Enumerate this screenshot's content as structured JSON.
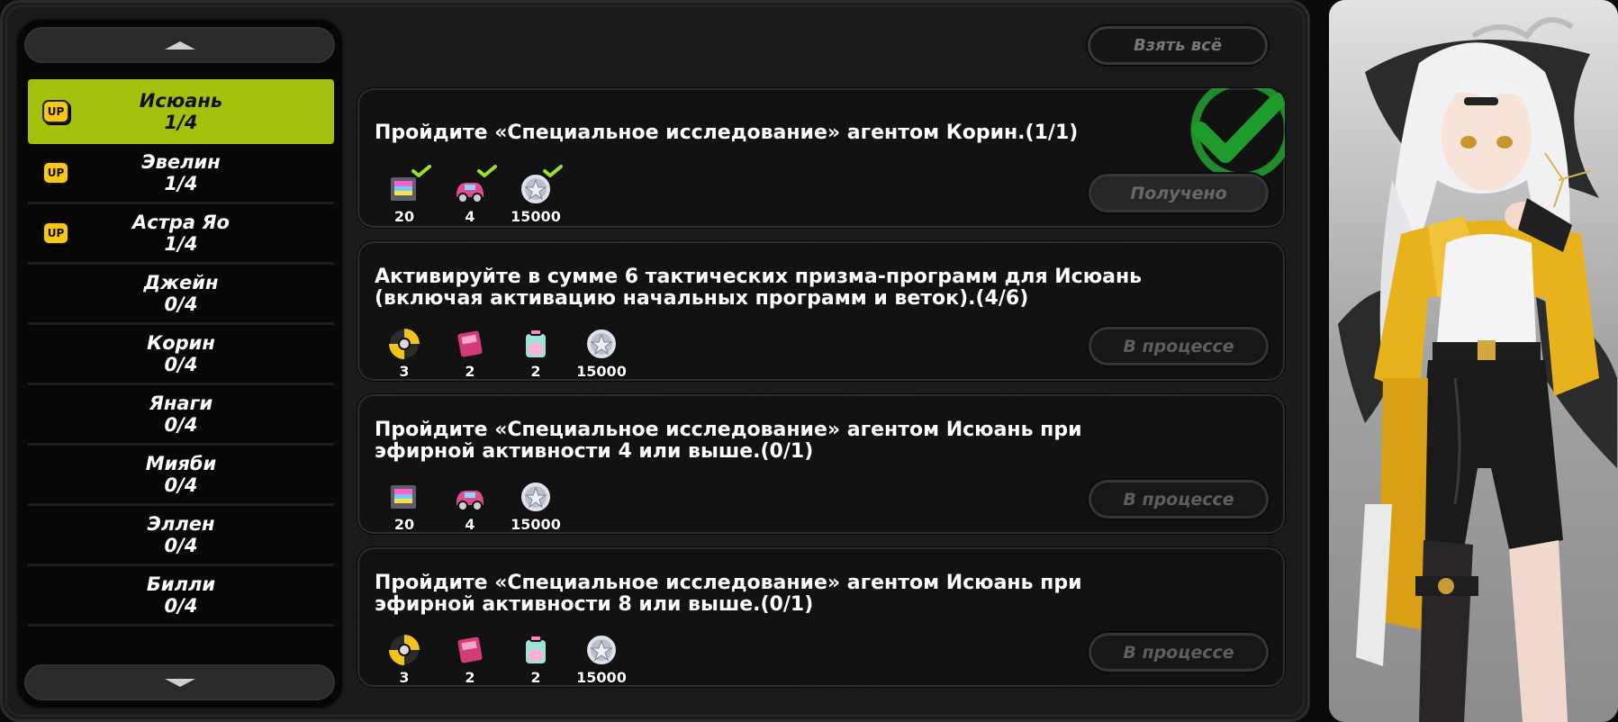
{
  "take_all_label": "Взять всё",
  "sidebar": {
    "agents": [
      {
        "name": "Исюань",
        "progress": "1/4",
        "up": "UP",
        "active": true
      },
      {
        "name": "Эвелин",
        "progress": "1/4",
        "up": "UP"
      },
      {
        "name": "Астра Яо",
        "progress": "1/4",
        "up": "UP"
      },
      {
        "name": "Джейн",
        "progress": "0/4"
      },
      {
        "name": "Корин",
        "progress": "0/4"
      },
      {
        "name": "Янаги",
        "progress": "0/4"
      },
      {
        "name": "Мияби",
        "progress": "0/4"
      },
      {
        "name": "Эллен",
        "progress": "0/4"
      },
      {
        "name": "Билли",
        "progress": "0/4"
      }
    ]
  },
  "tasks": [
    {
      "title": "Пройдите «Специальное исследование» агентом Корин.(1/1)",
      "status": "Получено",
      "completed": true,
      "rewards": [
        {
          "icon": "film-icon",
          "qty": "20",
          "claimed": true
        },
        {
          "icon": "car-icon",
          "qty": "4",
          "claimed": true
        },
        {
          "icon": "denny-coin-icon",
          "qty": "15000",
          "claimed": true
        }
      ]
    },
    {
      "title": "Активируйте в сумме 6 тактических призма-программ для Исюань (включая активацию начальных программ и веток).(4/6)",
      "status": "В процессе",
      "completed": false,
      "rewards": [
        {
          "icon": "disc-icon",
          "qty": "3"
        },
        {
          "icon": "pink-chip-icon",
          "qty": "2"
        },
        {
          "icon": "battery-icon",
          "qty": "2"
        },
        {
          "icon": "denny-coin-icon",
          "qty": "15000"
        }
      ]
    },
    {
      "title": "Пройдите «Специальное исследование» агентом Исюань при эфирной активности 4 или выше.(0/1)",
      "status": "В процессе",
      "completed": false,
      "rewards": [
        {
          "icon": "film-icon",
          "qty": "20"
        },
        {
          "icon": "car-icon",
          "qty": "4"
        },
        {
          "icon": "denny-coin-icon",
          "qty": "15000"
        }
      ]
    },
    {
      "title": "Пройдите «Специальное исследование» агентом Исюань при эфирной активности 8 или выше.(0/1)",
      "status": "В процессе",
      "completed": false,
      "rewards": [
        {
          "icon": "disc-icon",
          "qty": "3"
        },
        {
          "icon": "pink-chip-icon",
          "qty": "2"
        },
        {
          "icon": "battery-icon",
          "qty": "2"
        },
        {
          "icon": "denny-coin-icon",
          "qty": "15000"
        }
      ]
    }
  ],
  "colors": {
    "accent": "#a5c10c",
    "check": "#1f9a2c",
    "badge": "#f7c711"
  }
}
